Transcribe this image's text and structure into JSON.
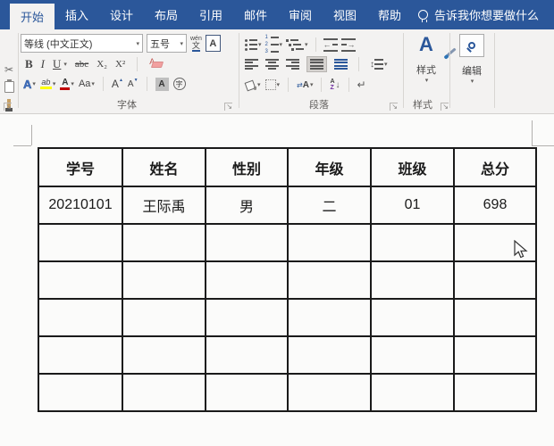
{
  "tabs": [
    {
      "label": "开始",
      "active": true
    },
    {
      "label": "插入"
    },
    {
      "label": "设计"
    },
    {
      "label": "布局"
    },
    {
      "label": "引用"
    },
    {
      "label": "邮件"
    },
    {
      "label": "审阅"
    },
    {
      "label": "视图"
    },
    {
      "label": "帮助"
    }
  ],
  "tell_me": {
    "label": "告诉我你想要做什么"
  },
  "icons": {
    "scissors": "✂",
    "dropdown": "▾",
    "launcher": "↘",
    "bullet_dot": "•",
    "indent_left_arrow": "←",
    "indent_right_arrow": "→",
    "line_spacing_arrows": "↕",
    "asian_layout_arrows": "⇄",
    "sort_arrow": "↓",
    "return_mark": "↵",
    "grow_arrow": "▲",
    "shrink_arrow": "▼"
  },
  "ribbon": {
    "font": {
      "group_label": "字体",
      "font_name": "等线 (中文正文)",
      "font_size": "五号",
      "phonetic_top": "wén",
      "phonetic_bottom": "文",
      "char_border": "A",
      "bold": "B",
      "italic": "I",
      "underline": "U",
      "strikethrough": "abc",
      "subscript": "X₂",
      "superscript": "X²",
      "clear_format": "A",
      "text_effects": "A",
      "highlight": "ab",
      "font_color": "A",
      "change_case": "Aa",
      "grow_font": "A",
      "shrink_font": "A",
      "char_shading": "A",
      "enclose_char": "字"
    },
    "paragraph": {
      "group_label": "段落",
      "numbering_digits": [
        "1",
        "2",
        "3"
      ],
      "asian_layout_letter": "A",
      "sort_a": "A",
      "sort_z": "Z"
    },
    "styles": {
      "group_label": "样式",
      "button_label": "样式",
      "icon_letter": "A"
    },
    "editing": {
      "button_label": "编辑"
    }
  },
  "document": {
    "table": {
      "columns": [
        "学号",
        "姓名",
        "性别",
        "年级",
        "班级",
        "总分"
      ],
      "rows": [
        [
          "20210101",
          "王际禹",
          "男",
          "二",
          "01",
          "698"
        ],
        [
          "",
          "",
          "",
          "",
          "",
          ""
        ],
        [
          "",
          "",
          "",
          "",
          "",
          ""
        ],
        [
          "",
          "",
          "",
          "",
          "",
          ""
        ],
        [
          "",
          "",
          "",
          "",
          "",
          ""
        ],
        [
          "",
          "",
          "",
          "",
          "",
          ""
        ]
      ]
    }
  },
  "colors": {
    "accent": "#2b579a",
    "ribbon_bg": "#f3f2f1",
    "highlight_yellow": "#ffff00",
    "font_color_red": "#c00000",
    "table_border": "#1a1a1a"
  }
}
